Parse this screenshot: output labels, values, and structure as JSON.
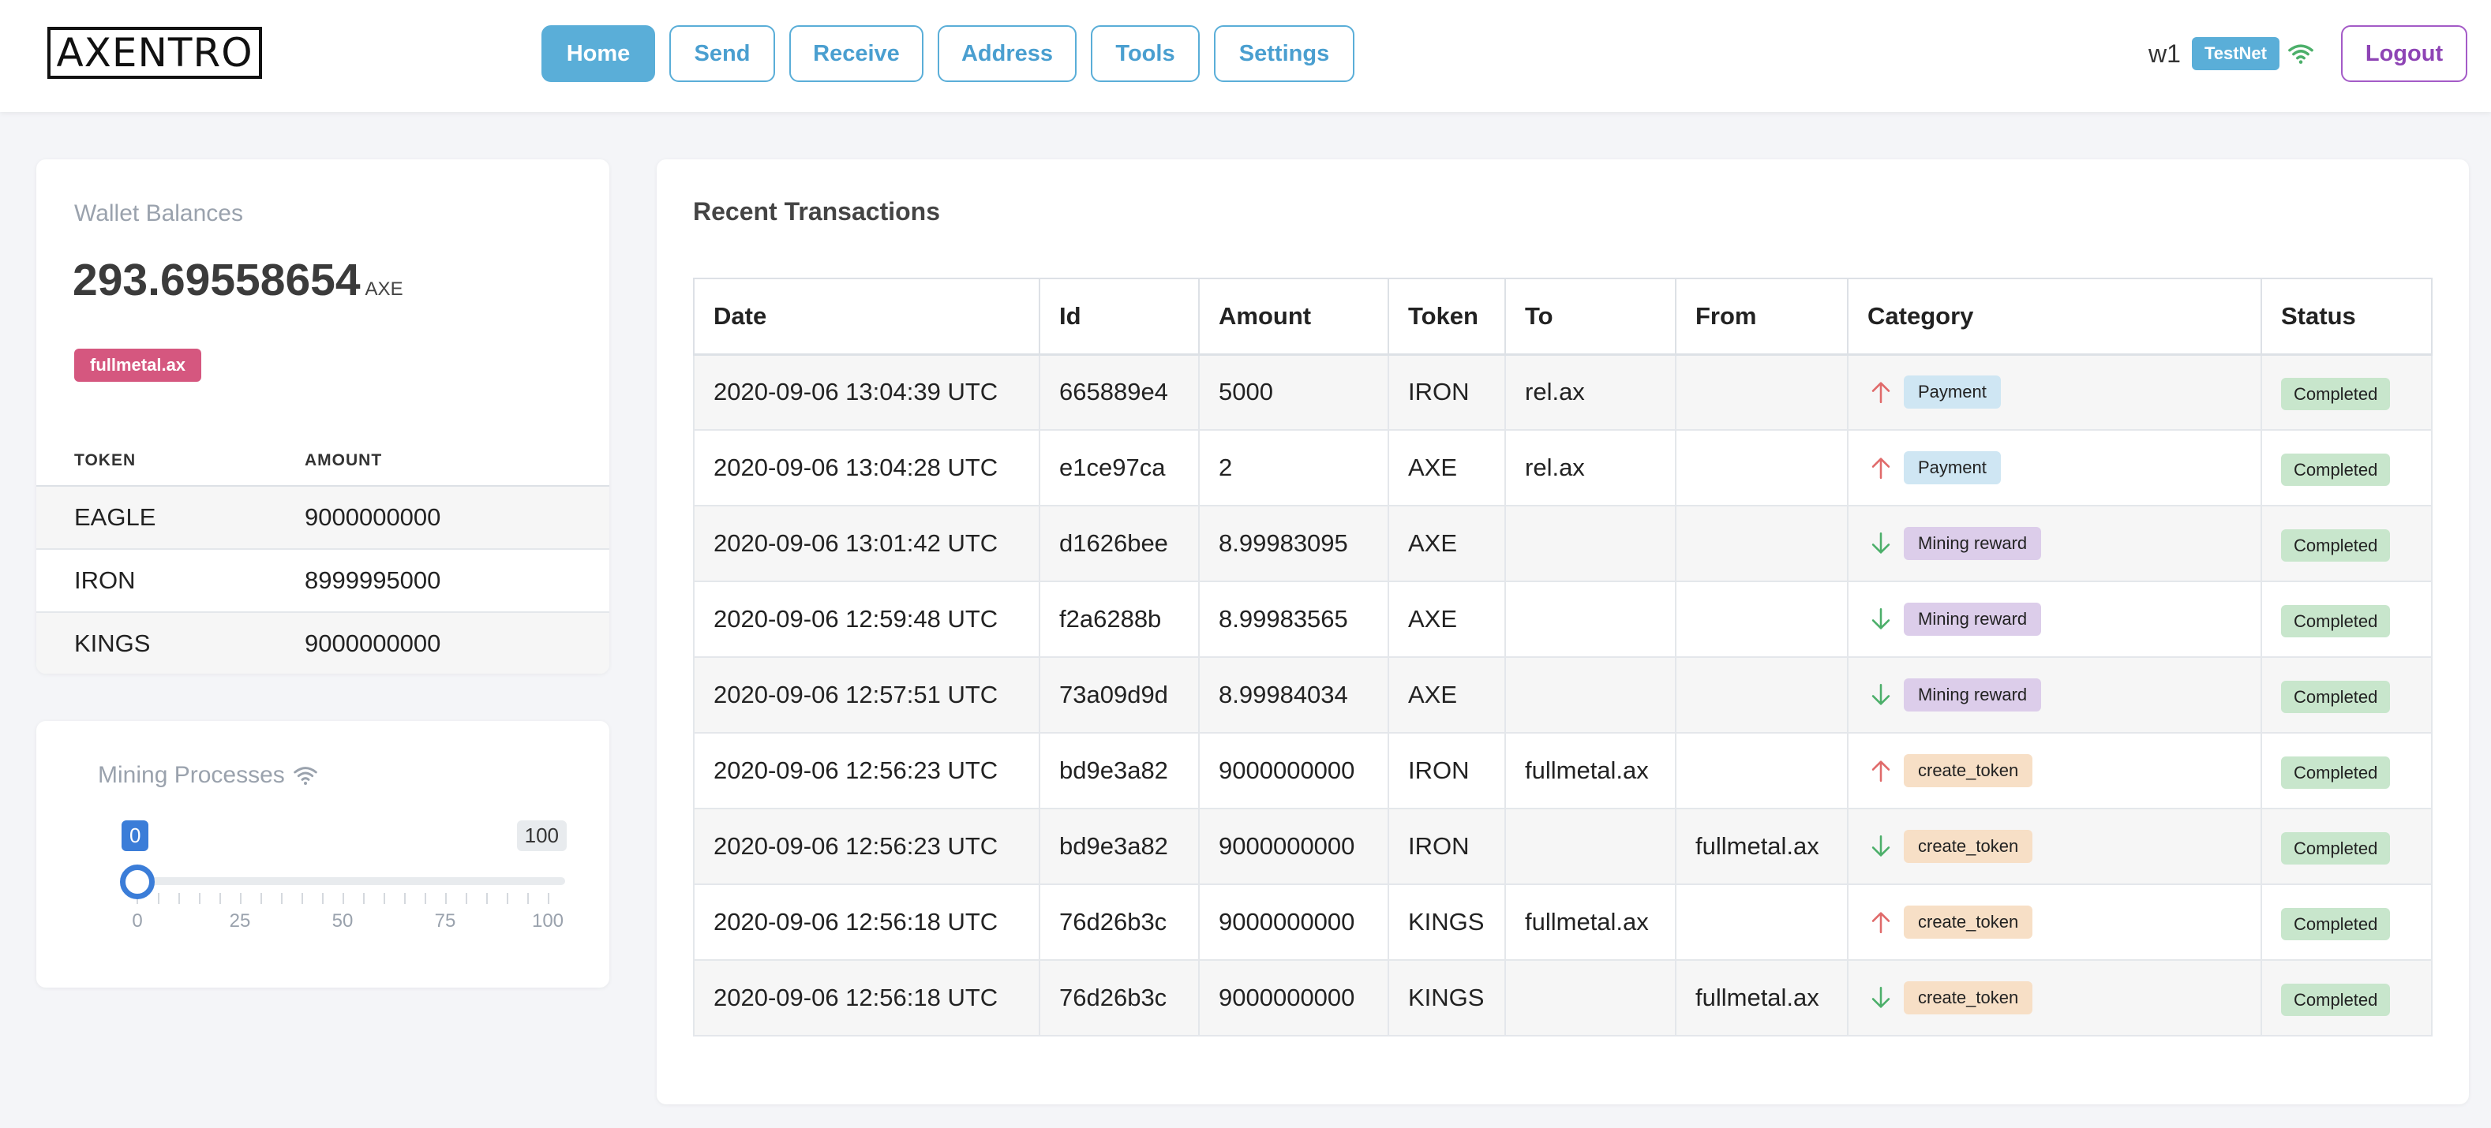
{
  "header": {
    "logo": "AXENTRO",
    "nav": [
      {
        "label": "Home",
        "active": true
      },
      {
        "label": "Send",
        "active": false
      },
      {
        "label": "Receive",
        "active": false
      },
      {
        "label": "Address",
        "active": false
      },
      {
        "label": "Tools",
        "active": false
      },
      {
        "label": "Settings",
        "active": false
      }
    ],
    "wallet_name": "w1",
    "network": "TestNet",
    "logout_label": "Logout"
  },
  "balances": {
    "title": "Wallet Balances",
    "amount": "293.69558654",
    "unit": "AXE",
    "address": "fullmetal.ax",
    "columns": [
      "TOKEN",
      "AMOUNT"
    ],
    "rows": [
      {
        "token": "EAGLE",
        "amount": "9000000000"
      },
      {
        "token": "IRON",
        "amount": "8999995000"
      },
      {
        "token": "KINGS",
        "amount": "9000000000"
      }
    ]
  },
  "mining": {
    "title": "Mining Processes",
    "value": "0",
    "max": "100",
    "tick_labels": [
      "0",
      "25",
      "50",
      "75",
      "100"
    ]
  },
  "transactions": {
    "title": "Recent Transactions",
    "columns": [
      "Date",
      "Id",
      "Amount",
      "Token",
      "To",
      "From",
      "Category",
      "Status"
    ],
    "rows": [
      {
        "date": "2020-09-06 13:04:39 UTC",
        "id": "665889e4",
        "amount": "5000",
        "token": "IRON",
        "to": "rel.ax",
        "from": "",
        "direction": "out",
        "category": "Payment",
        "cat_type": "payment",
        "status": "Completed"
      },
      {
        "date": "2020-09-06 13:04:28 UTC",
        "id": "e1ce97ca",
        "amount": "2",
        "token": "AXE",
        "to": "rel.ax",
        "from": "",
        "direction": "out",
        "category": "Payment",
        "cat_type": "payment",
        "status": "Completed"
      },
      {
        "date": "2020-09-06 13:01:42 UTC",
        "id": "d1626bee",
        "amount": "8.99983095",
        "token": "AXE",
        "to": "",
        "from": "",
        "direction": "in",
        "category": "Mining reward",
        "cat_type": "mining",
        "status": "Completed"
      },
      {
        "date": "2020-09-06 12:59:48 UTC",
        "id": "f2a6288b",
        "amount": "8.99983565",
        "token": "AXE",
        "to": "",
        "from": "",
        "direction": "in",
        "category": "Mining reward",
        "cat_type": "mining",
        "status": "Completed"
      },
      {
        "date": "2020-09-06 12:57:51 UTC",
        "id": "73a09d9d",
        "amount": "8.99984034",
        "token": "AXE",
        "to": "",
        "from": "",
        "direction": "in",
        "category": "Mining reward",
        "cat_type": "mining",
        "status": "Completed"
      },
      {
        "date": "2020-09-06 12:56:23 UTC",
        "id": "bd9e3a82",
        "amount": "9000000000",
        "token": "IRON",
        "to": "fullmetal.ax",
        "from": "",
        "direction": "out",
        "category": "create_token",
        "cat_type": "token",
        "status": "Completed"
      },
      {
        "date": "2020-09-06 12:56:23 UTC",
        "id": "bd9e3a82",
        "amount": "9000000000",
        "token": "IRON",
        "to": "",
        "from": "fullmetal.ax",
        "direction": "in",
        "category": "create_token",
        "cat_type": "token",
        "status": "Completed"
      },
      {
        "date": "2020-09-06 12:56:18 UTC",
        "id": "76d26b3c",
        "amount": "9000000000",
        "token": "KINGS",
        "to": "fullmetal.ax",
        "from": "",
        "direction": "out",
        "category": "create_token",
        "cat_type": "token",
        "status": "Completed"
      },
      {
        "date": "2020-09-06 12:56:18 UTC",
        "id": "76d26b3c",
        "amount": "9000000000",
        "token": "KINGS",
        "to": "",
        "from": "fullmetal.ax",
        "direction": "in",
        "category": "create_token",
        "cat_type": "token",
        "status": "Completed"
      }
    ]
  },
  "colors": {
    "primary": "#5aaed8",
    "logout": "#8e44b5",
    "address_badge": "#d5577f",
    "slider": "#3b7dd8",
    "arrow_out": "#e06a6a",
    "arrow_in": "#4caf6a"
  }
}
